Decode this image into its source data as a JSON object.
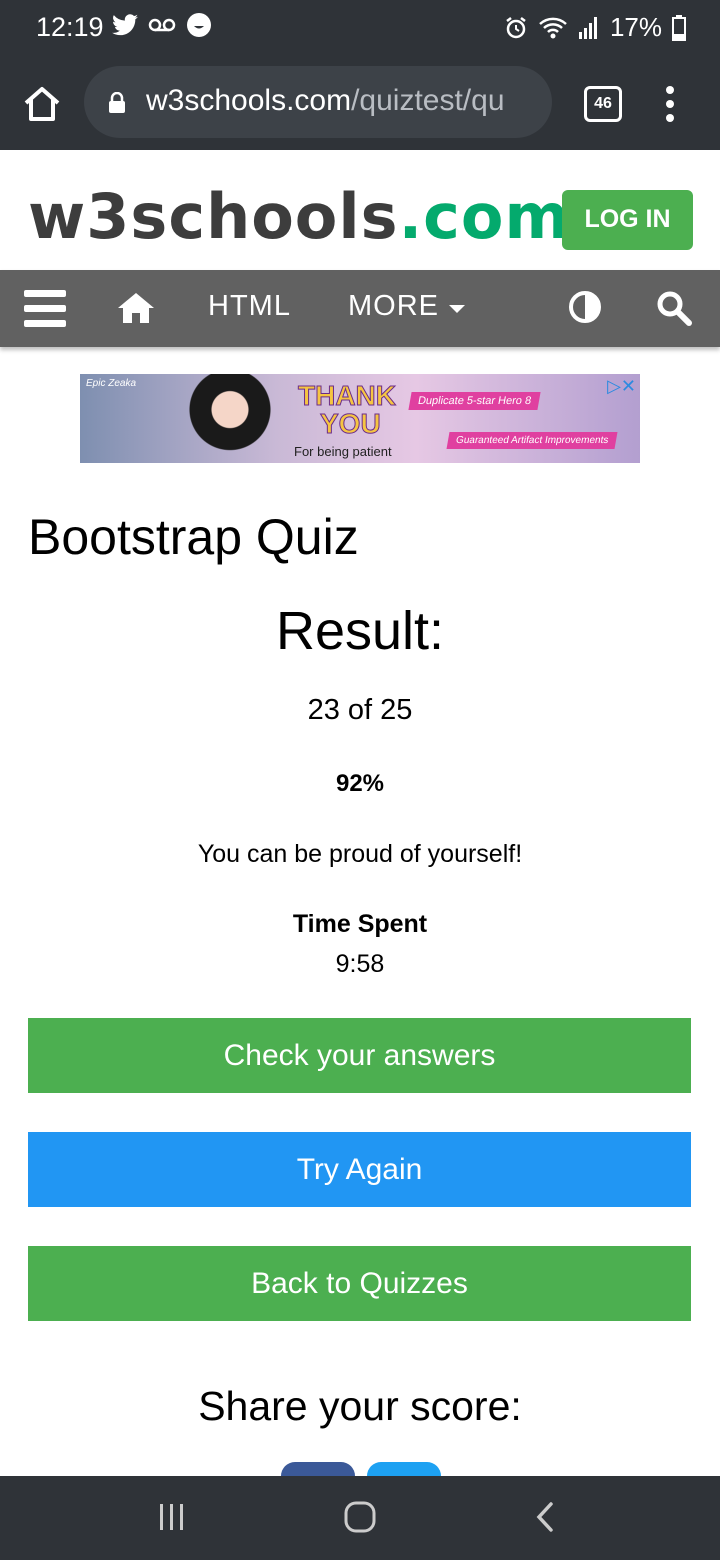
{
  "status_bar": {
    "time": "12:19",
    "battery": "17%",
    "icons": [
      "twitter-icon",
      "voicemail-icon",
      "bubble-icon",
      "alarm-icon",
      "wifi-icon",
      "signal-icon",
      "battery-icon"
    ]
  },
  "browser": {
    "url_domain": "w3schools.com",
    "url_path": "/quiztest/qu",
    "tab_count": "46"
  },
  "site": {
    "logo_main": "w3schools",
    "logo_tld": ".com",
    "login_label": "LOG IN"
  },
  "navbar": {
    "html_label": "HTML",
    "more_label": "MORE"
  },
  "ad": {
    "small_text": "Epic Zeaka",
    "thank": "THANK",
    "you": "YOU",
    "patient": "For being patient",
    "promo1": "Duplicate 5-star Hero 8",
    "promo2": "Guaranteed Artifact Improvements",
    "adchoices": "▷✕"
  },
  "quiz": {
    "title": "Bootstrap Quiz",
    "result_label": "Result:",
    "score": "23 of 25",
    "percent": "92%",
    "message": "You can be proud of yourself!",
    "time_label": "Time Spent",
    "time_value": "9:58"
  },
  "buttons": {
    "check": "Check your answers",
    "try": "Try Again",
    "back": "Back to Quizzes"
  },
  "share": {
    "label": "Share your score:"
  },
  "colors": {
    "green": "#4caf50",
    "blue": "#2196f3",
    "navbar": "#616161",
    "chrome": "#2f3338"
  }
}
